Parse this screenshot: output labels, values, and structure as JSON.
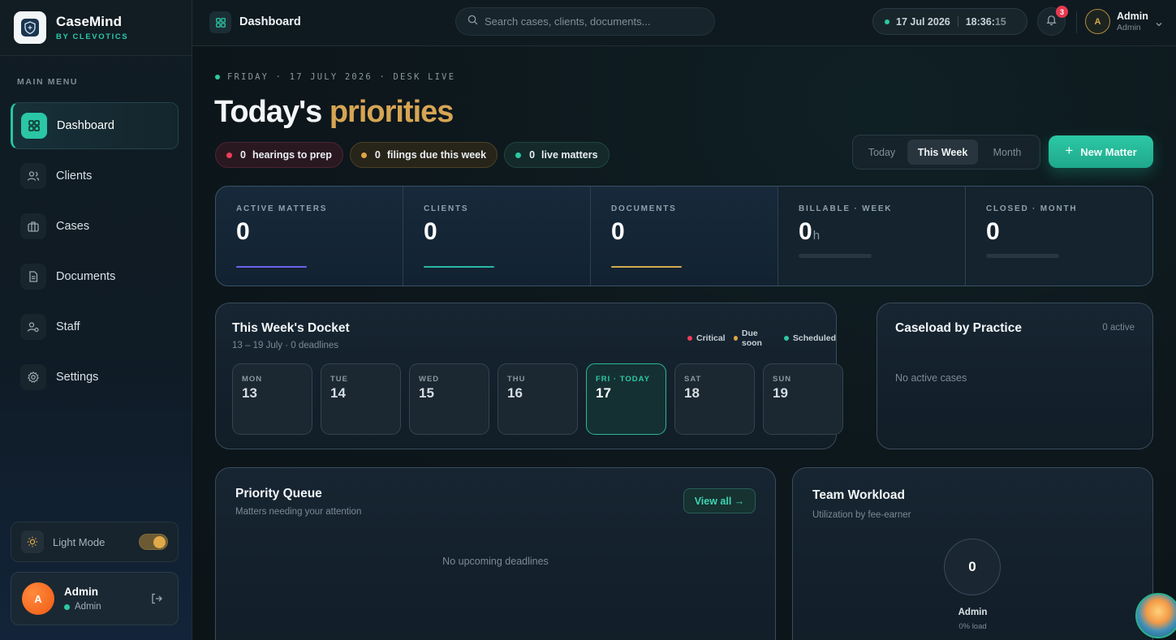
{
  "brand": {
    "name": "CaseMind",
    "tagline": "BY CLEVOTICS"
  },
  "sidebar": {
    "menu_title": "MAIN MENU",
    "items": [
      {
        "label": "Dashboard",
        "icon": "grid-icon",
        "active": true
      },
      {
        "label": "Clients",
        "icon": "users-icon"
      },
      {
        "label": "Cases",
        "icon": "briefcase-icon"
      },
      {
        "label": "Documents",
        "icon": "document-icon"
      },
      {
        "label": "Staff",
        "icon": "staff-icon"
      },
      {
        "label": "Settings",
        "icon": "gear-icon"
      }
    ],
    "mode_label": "Light Mode",
    "user": {
      "initial": "A",
      "name": "Admin",
      "role": "Admin"
    }
  },
  "topbar": {
    "title": "Dashboard",
    "search_placeholder": "Search cases, clients, documents...",
    "date": "17 Jul 2026",
    "time_hm": "18:36:",
    "time_s": "15",
    "notifications": "3",
    "user": {
      "initial": "A",
      "name": "Admin",
      "role": "Admin"
    }
  },
  "hero": {
    "eyebrow": "FRIDAY · 17 JULY 2026 · DESK LIVE",
    "headline_main": "Today's ",
    "headline_accent": "priorities",
    "pills": [
      {
        "count": "0",
        "label": "hearings to prep"
      },
      {
        "count": "0",
        "label": "filings due this week"
      },
      {
        "count": "0",
        "label": "live matters"
      }
    ],
    "ranges": [
      "Today",
      "This Week",
      "Month"
    ],
    "active_range": "This Week",
    "new_button": "New Matter"
  },
  "stats": [
    {
      "label": "ACTIVE MATTERS",
      "value": "0",
      "unit": ""
    },
    {
      "label": "CLIENTS",
      "value": "0",
      "unit": ""
    },
    {
      "label": "DOCUMENTS",
      "value": "0",
      "unit": ""
    },
    {
      "label": "BILLABLE · WEEK",
      "value": "0",
      "unit": "h"
    },
    {
      "label": "CLOSED · MONTH",
      "value": "0",
      "unit": ""
    }
  ],
  "docket": {
    "title": "This Week's Docket",
    "subtitle": "13 – 19 July · 0 deadlines",
    "legend": [
      "Critical",
      "Due soon",
      "Scheduled"
    ],
    "days": [
      {
        "name": "MON",
        "num": "13"
      },
      {
        "name": "TUE",
        "num": "14"
      },
      {
        "name": "WED",
        "num": "15"
      },
      {
        "name": "THU",
        "num": "16"
      },
      {
        "name": "FRI · TODAY",
        "num": "17"
      },
      {
        "name": "SAT",
        "num": "18"
      },
      {
        "name": "SUN",
        "num": "19"
      }
    ]
  },
  "caseload": {
    "title": "Caseload by Practice",
    "count": "0 active",
    "empty": "No active cases"
  },
  "priority": {
    "title": "Priority Queue",
    "subtitle": "Matters needing your attention",
    "view_all": "View all →",
    "empty": "No upcoming deadlines"
  },
  "workload": {
    "title": "Team Workload",
    "subtitle": "Utilization by fee-earner",
    "value": "0",
    "name": "Admin",
    "load": "0% load"
  },
  "colors": {
    "accent": "#2cc9a6",
    "gold": "#d6a553",
    "critical": "#ee3d5a",
    "due_soon": "#e0a347",
    "scheduled": "#2cc7a3"
  }
}
